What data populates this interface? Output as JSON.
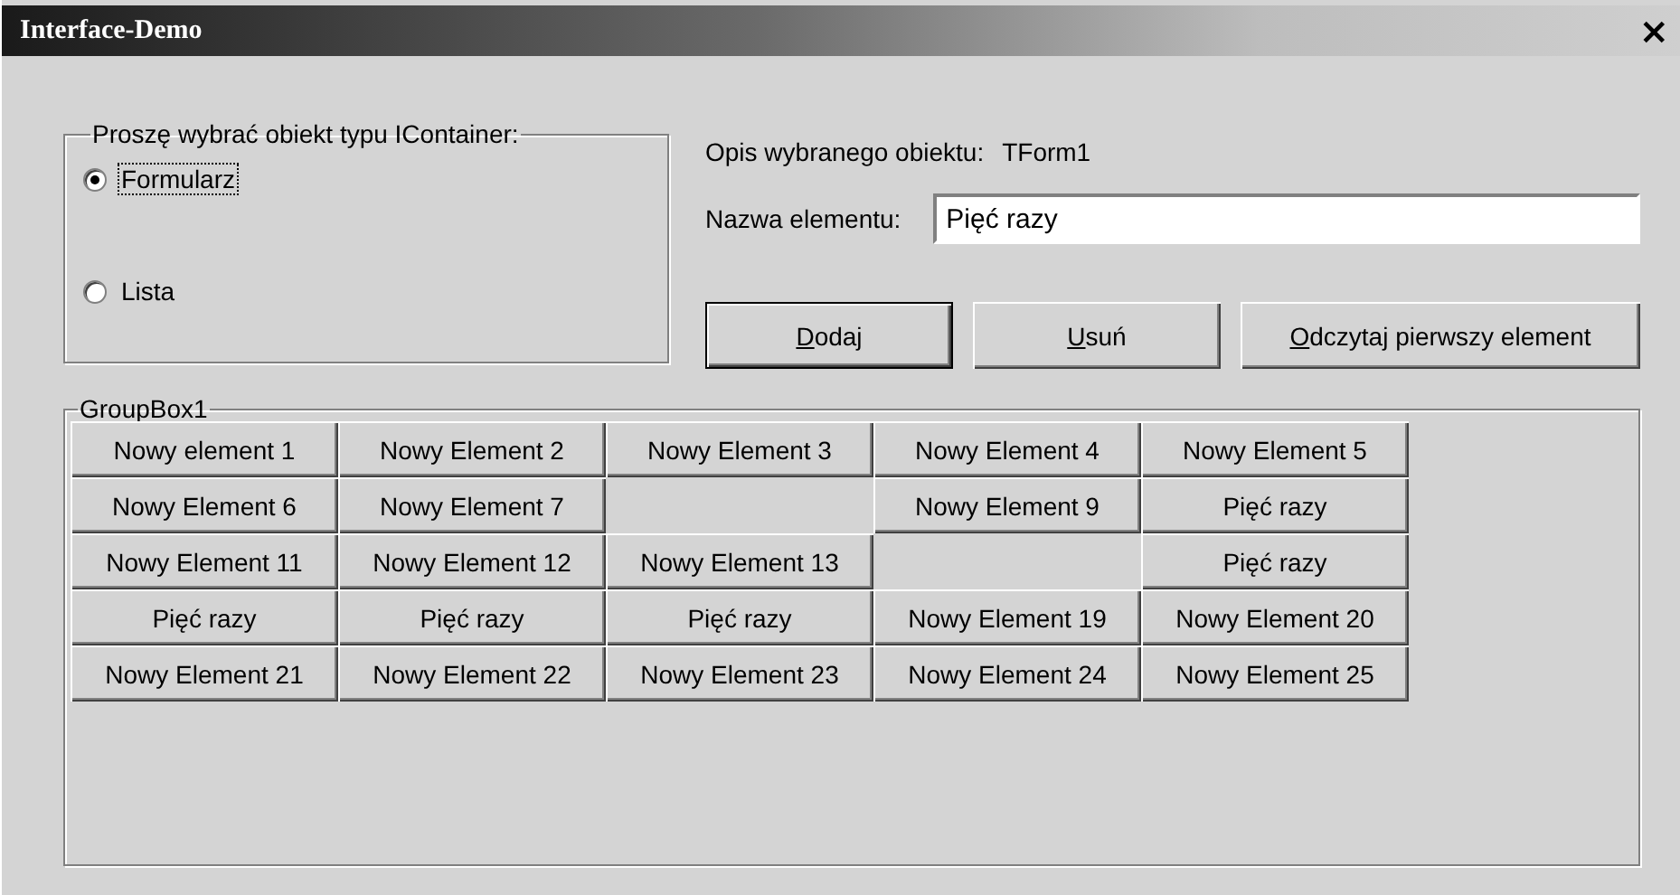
{
  "window": {
    "title": "Interface-Demo",
    "close": "×"
  },
  "container_group": {
    "title": "Proszę wybrać obiekt typu IContainer:",
    "options": [
      {
        "label": "Formularz",
        "selected": true,
        "focused": true
      },
      {
        "label": "Lista",
        "selected": false,
        "focused": false
      }
    ]
  },
  "description": {
    "label": "Opis wybranego obiektu:",
    "value": "TForm1"
  },
  "name_field": {
    "label": "Nazwa elementu:",
    "value": "Pięć razy"
  },
  "buttons": [
    {
      "label": "Dodaj",
      "default": true
    },
    {
      "label": "Usuń",
      "default": false
    },
    {
      "label": "Odczytaj pierwszy element",
      "default": false
    }
  ],
  "group_box": {
    "title": "GroupBox1",
    "cells": [
      {
        "kind": "button",
        "label": "Nowy element 1"
      },
      {
        "kind": "button",
        "label": "Nowy Element 2"
      },
      {
        "kind": "button",
        "label": "Nowy Element 3"
      },
      {
        "kind": "button",
        "label": "Nowy Element 4"
      },
      {
        "kind": "button",
        "label": "Nowy Element 5"
      },
      {
        "kind": "button",
        "label": "Nowy Element 6"
      },
      {
        "kind": "button",
        "label": "Nowy Element 7"
      },
      {
        "kind": "empty"
      },
      {
        "kind": "button",
        "label": "Nowy Element 9"
      },
      {
        "kind": "button",
        "label": "Pięć razy"
      },
      {
        "kind": "button",
        "label": "Nowy Element 11"
      },
      {
        "kind": "button",
        "label": "Nowy Element 12"
      },
      {
        "kind": "button",
        "label": "Nowy Element 13"
      },
      {
        "kind": "empty"
      },
      {
        "kind": "button",
        "label": "Pięć razy"
      },
      {
        "kind": "button",
        "label": "Pięć razy"
      },
      {
        "kind": "button",
        "label": "Pięć razy"
      },
      {
        "kind": "button",
        "label": "Pięć razy"
      },
      {
        "kind": "button",
        "label": "Nowy Element 19"
      },
      {
        "kind": "button",
        "label": "Nowy Element 20"
      },
      {
        "kind": "button",
        "label": "Nowy Element 21"
      },
      {
        "kind": "button",
        "label": "Nowy Element 22"
      },
      {
        "kind": "button",
        "label": "Nowy Element 23"
      },
      {
        "kind": "button",
        "label": "Nowy Element 24"
      },
      {
        "kind": "button",
        "label": "Nowy Element 25"
      }
    ]
  }
}
